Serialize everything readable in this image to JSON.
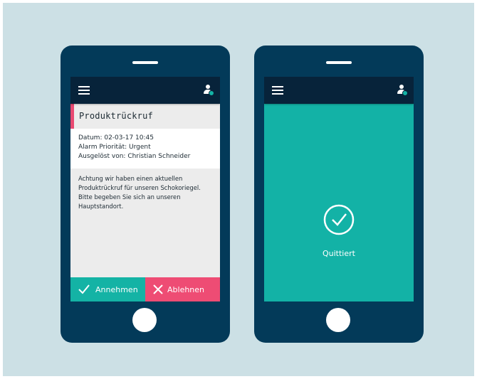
{
  "colors": {
    "background": "#cce0e5",
    "phone_body": "#033a59",
    "app_bar": "#07233a",
    "accent_teal": "#14b3a5",
    "accent_pink": "#ee4c74"
  },
  "icons": {
    "menu": "hamburger-menu-icon",
    "user": "user-status-icon",
    "accept": "checkmark-icon",
    "decline": "x-icon",
    "confirmed": "circle-check-icon"
  },
  "alert_screen": {
    "title": "Produktrückruf",
    "meta": {
      "date": "Datum: 02-03-17 10:45",
      "priority": "Alarm Priorität: Urgent",
      "triggered_by": "Ausgelöst von: Christian Schneider"
    },
    "message_lines": [
      "Achtung wir haben einen aktuellen",
      "Produktrückruf für unseren Schokoriegel.",
      "Bitte begeben Sie sich an unseren",
      "Hauptstandort."
    ],
    "accept_label": "Annehmen",
    "decline_label": "Ablehnen"
  },
  "confirm_screen": {
    "status_label": "Quittiert"
  }
}
